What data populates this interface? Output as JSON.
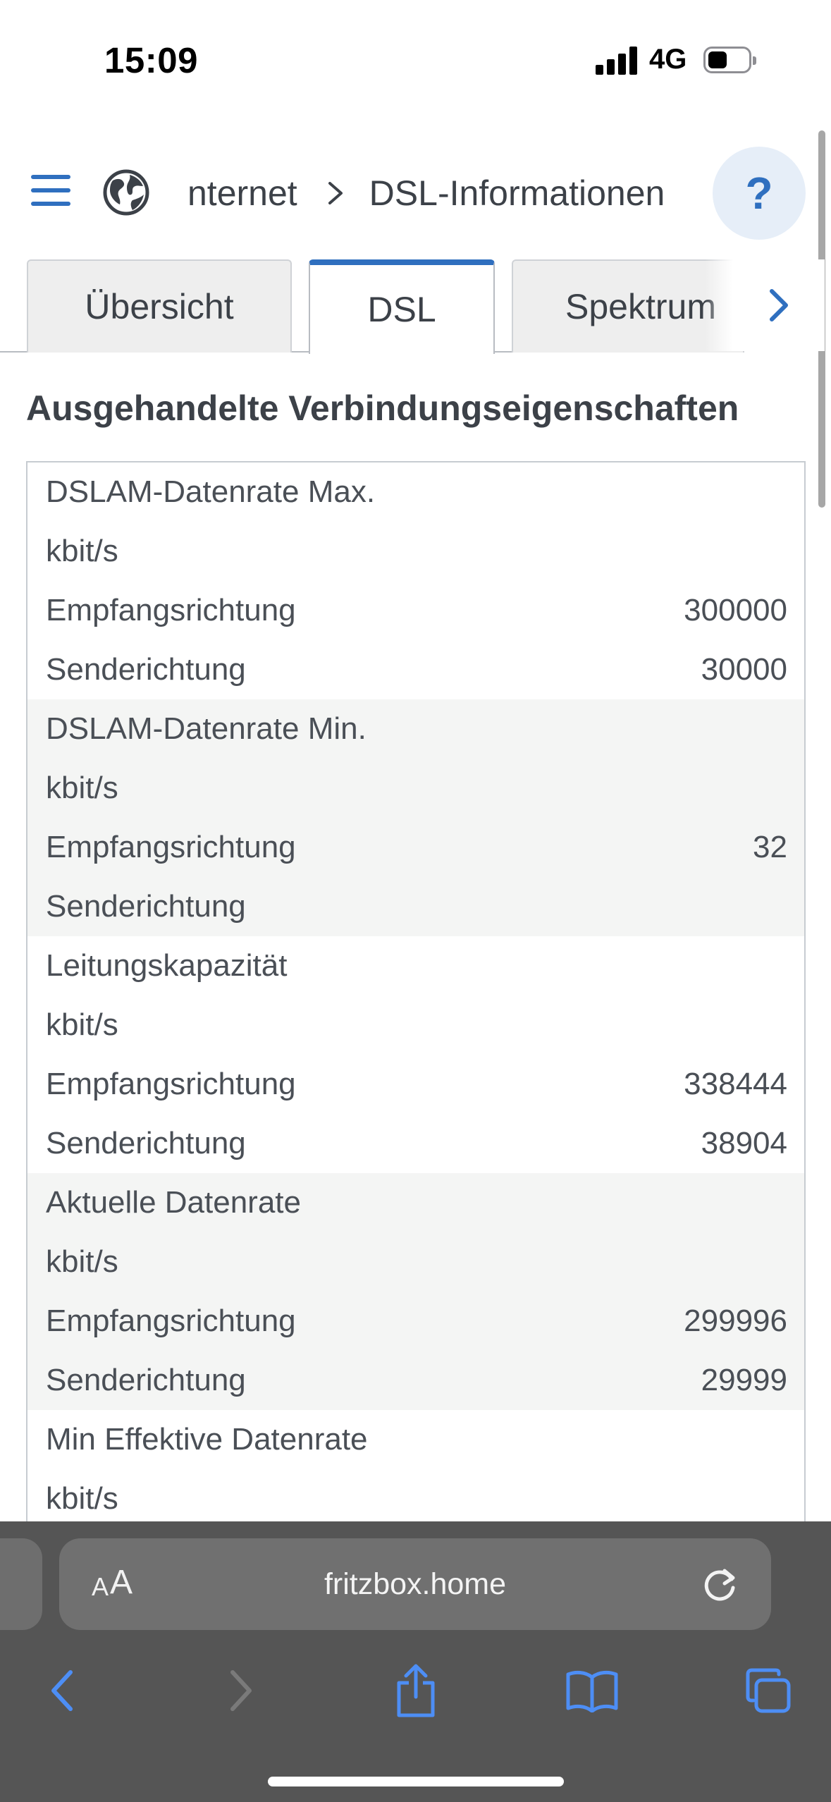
{
  "status": {
    "time": "15:09",
    "network": "4G"
  },
  "header": {
    "breadcrumb_parent": "nternet",
    "breadcrumb_current": "DSL-Informationen",
    "help_label": "?"
  },
  "tabs": [
    {
      "label": "Übersicht"
    },
    {
      "label": "DSL"
    },
    {
      "label": "Spektrum"
    }
  ],
  "section": {
    "title": "Ausgehandelte Verbindungseigenschaften"
  },
  "groups": [
    {
      "title": "DSLAM-Datenrate Max.",
      "unit": "kbit/s",
      "rx_label": "Empfangsrichtung",
      "rx_value": "300000",
      "tx_label": "Senderichtung",
      "tx_value": "30000"
    },
    {
      "title": "DSLAM-Datenrate Min.",
      "unit": "kbit/s",
      "rx_label": "Empfangsrichtung",
      "rx_value": "32",
      "tx_label": "Senderichtung",
      "tx_value": ""
    },
    {
      "title": "Leitungskapazität",
      "unit": "kbit/s",
      "rx_label": "Empfangsrichtung",
      "rx_value": "338444",
      "tx_label": "Senderichtung",
      "tx_value": "38904"
    },
    {
      "title": "Aktuelle Datenrate",
      "unit": "kbit/s",
      "rx_label": "Empfangsrichtung",
      "rx_value": "299996",
      "tx_label": "Senderichtung",
      "tx_value": "29999"
    },
    {
      "title": "Min Effektive Datenrate",
      "unit": "kbit/s"
    }
  ],
  "browser": {
    "aa_small": "A",
    "aa_big": "A",
    "url": "fritzbox.home"
  },
  "colors": {
    "accent": "#2f6fbf",
    "alt_row": "#f4f5f4",
    "safari_bar": "#555555"
  }
}
